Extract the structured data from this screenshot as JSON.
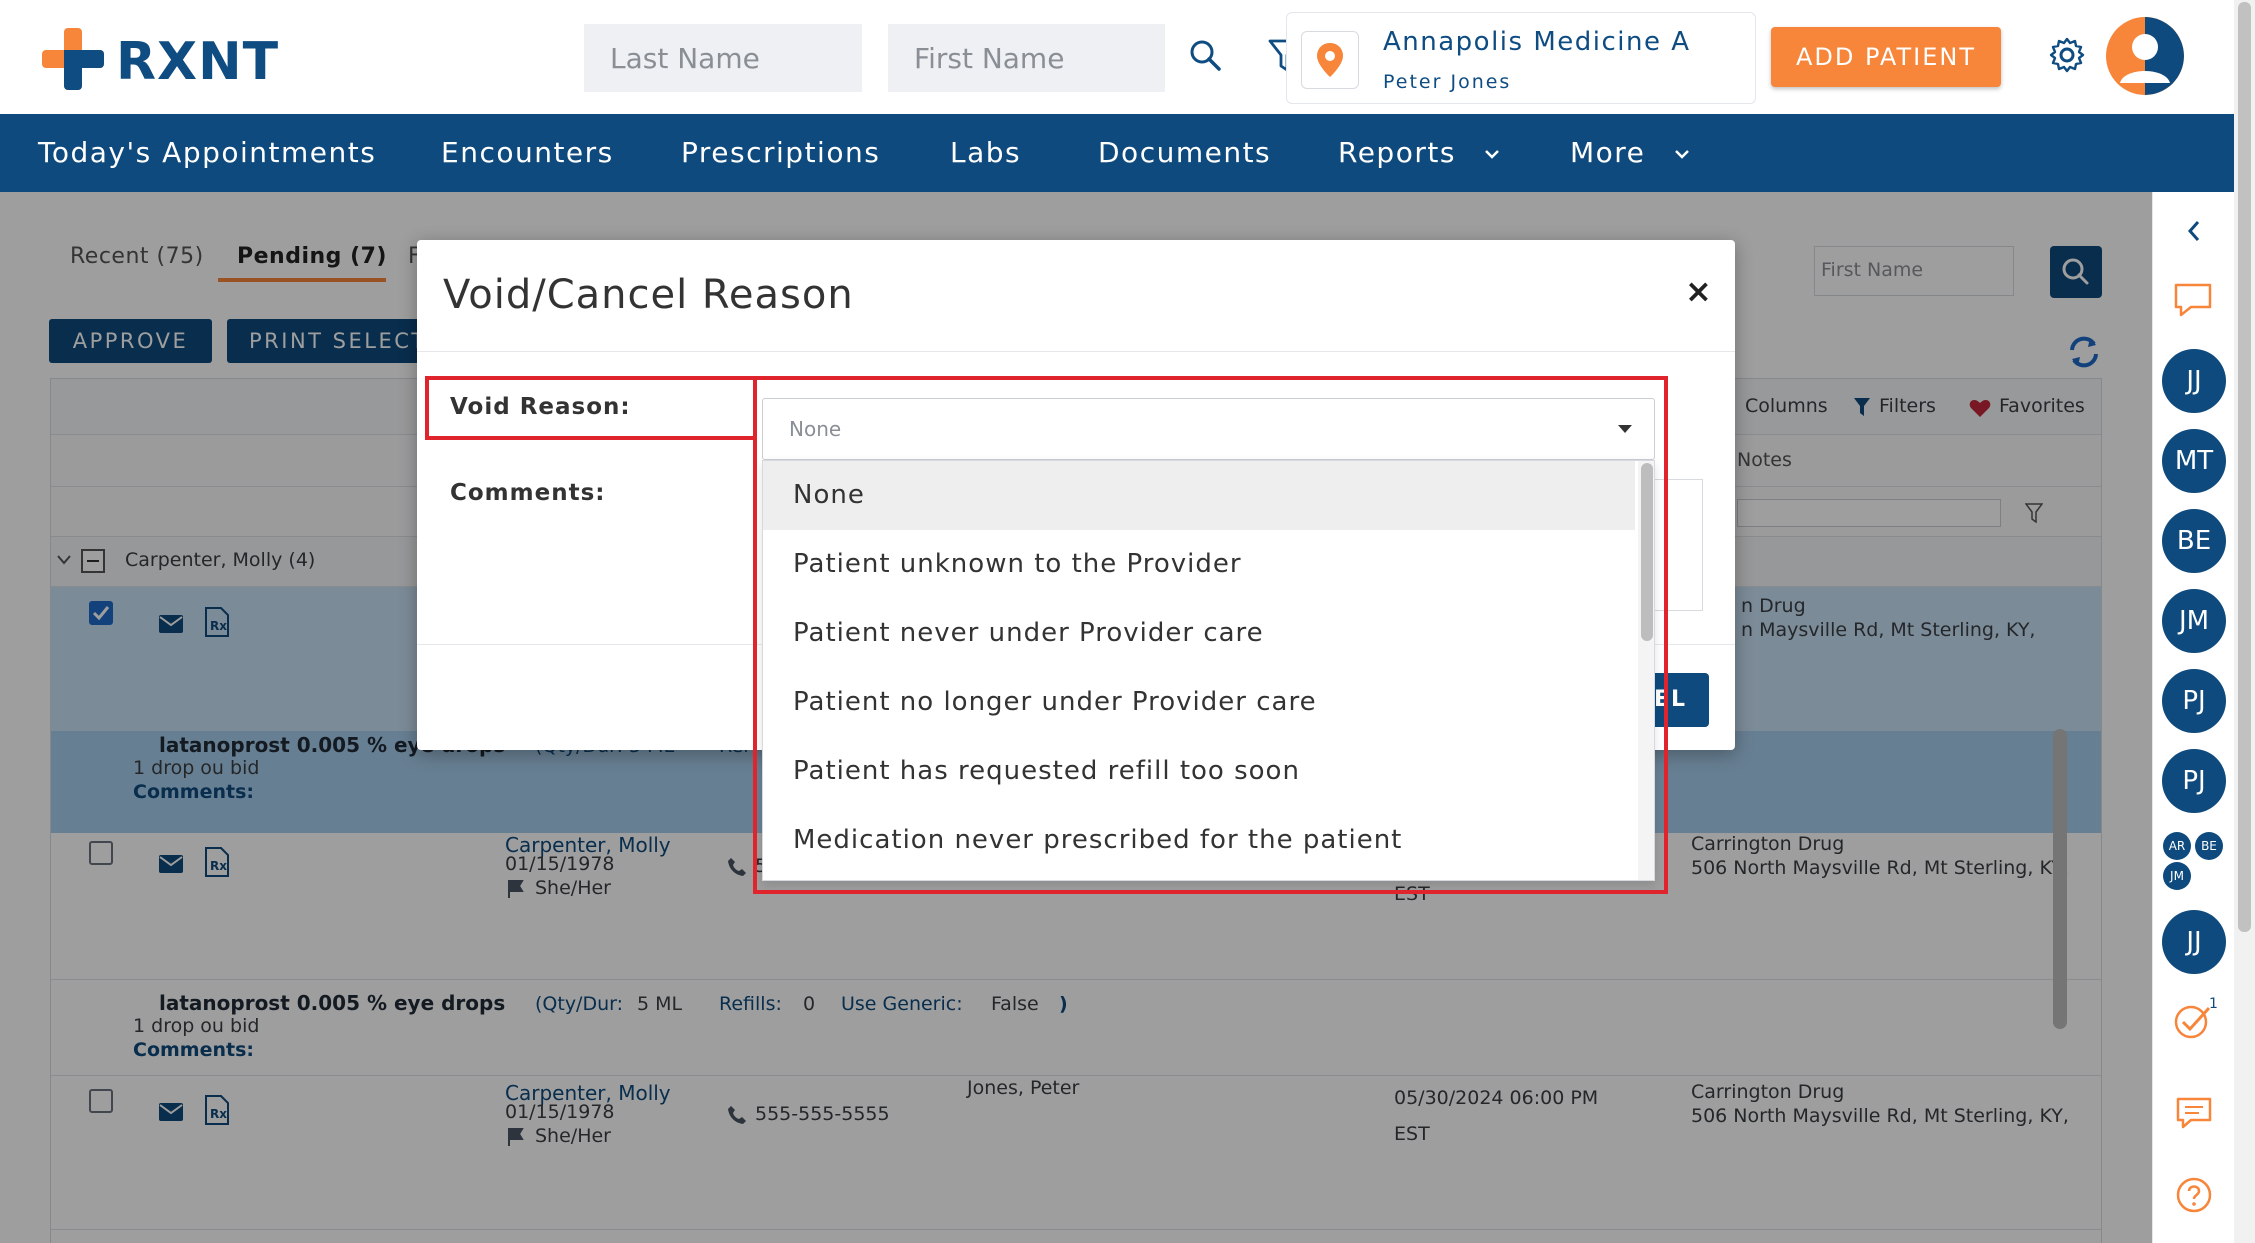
{
  "brand": {
    "name": "RXNT",
    "orange": "#f7853a",
    "navy": "#0e4a7d"
  },
  "header": {
    "last_name_placeholder": "Last Name",
    "first_name_placeholder": "First Name",
    "location_name": "Annapolis Medicine A",
    "location_user": "Peter Jones",
    "add_patient_label": "ADD PATIENT",
    "icons": [
      "search-icon",
      "filter-icon",
      "location-pin-icon",
      "gear-icon",
      "user-avatar-icon"
    ]
  },
  "nav": {
    "items": [
      "Today's Appointments",
      "Encounters",
      "Prescriptions",
      "Labs",
      "Documents",
      "Reports",
      "More"
    ]
  },
  "page": {
    "tabs": {
      "recent": "Recent (75)",
      "pending": "Pending (7)",
      "partial": "F"
    },
    "approve_label": "APPROVE",
    "print_label": "PRINT SELECT",
    "search_first_name_placeholder": "First Name",
    "toolbar": {
      "columns": "Columns",
      "filters": "Filters",
      "favorites": "Favorites"
    },
    "notes_header": "Notes",
    "group_label": "Carpenter, Molly (4)",
    "rows": [
      {
        "pharmacy_name": "n Drug",
        "pharmacy_addr": "n Maysville Rd, Mt Sterling, KY,",
        "drug": "latanoprost 0.005 % eye drops",
        "qty_partial": "(Qty/Dur: 5 ML",
        "refills_partial": "Ref",
        "sig": "1 drop ou bid",
        "comments_label": "Comments:"
      },
      {
        "patient": "Carpenter, Molly",
        "dob": "01/15/1978",
        "pronouns": "She/Her",
        "phone_partial": "5",
        "pharmacy_name": "Carrington Drug",
        "pharmacy_addr": "506 North Maysville Rd, Mt Sterling, KY,",
        "tz": "EST",
        "drug": "latanoprost 0.005 % eye drops",
        "qty_label": "(Qty/Dur:",
        "qty_value": "5 ML",
        "refills_label": "Refills:",
        "refills_value": "0",
        "generic_label": "Use Generic:",
        "generic_value": "False",
        "close_paren": ")",
        "sig": "1 drop ou bid",
        "comments_label": "Comments:"
      },
      {
        "patient": "Carpenter, Molly",
        "dob": "01/15/1978",
        "pronouns": "She/Her",
        "phone": "555-555-5555",
        "prescriber": "Jones, Peter",
        "datetime": "05/30/2024 06:00 PM",
        "tz": "EST",
        "pharmacy_name": "Carrington Drug",
        "pharmacy_addr": "506 North Maysville Rd, Mt Sterling, KY,"
      }
    ]
  },
  "sidebar": {
    "avatars": [
      "JJ",
      "MT",
      "BE",
      "JM",
      "PJ",
      "PJ"
    ],
    "mini_avatars": [
      "AR",
      "BE",
      "JM"
    ],
    "last_avatar": "JJ",
    "task_badge": "1"
  },
  "modal": {
    "title": "Void/Cancel Reason",
    "close": "×",
    "void_reason_label": "Void Reason:",
    "comments_label": "Comments:",
    "selected_value": "None",
    "cancel_partial": "EL",
    "options": [
      "None",
      "Patient unknown to the Provider",
      "Patient never under Provider care",
      "Patient no longer under Provider care",
      "Patient has requested refill too soon",
      "Medication never prescribed for the patient"
    ],
    "highlighted_index": 0,
    "highlight_color": "#e0242e"
  }
}
